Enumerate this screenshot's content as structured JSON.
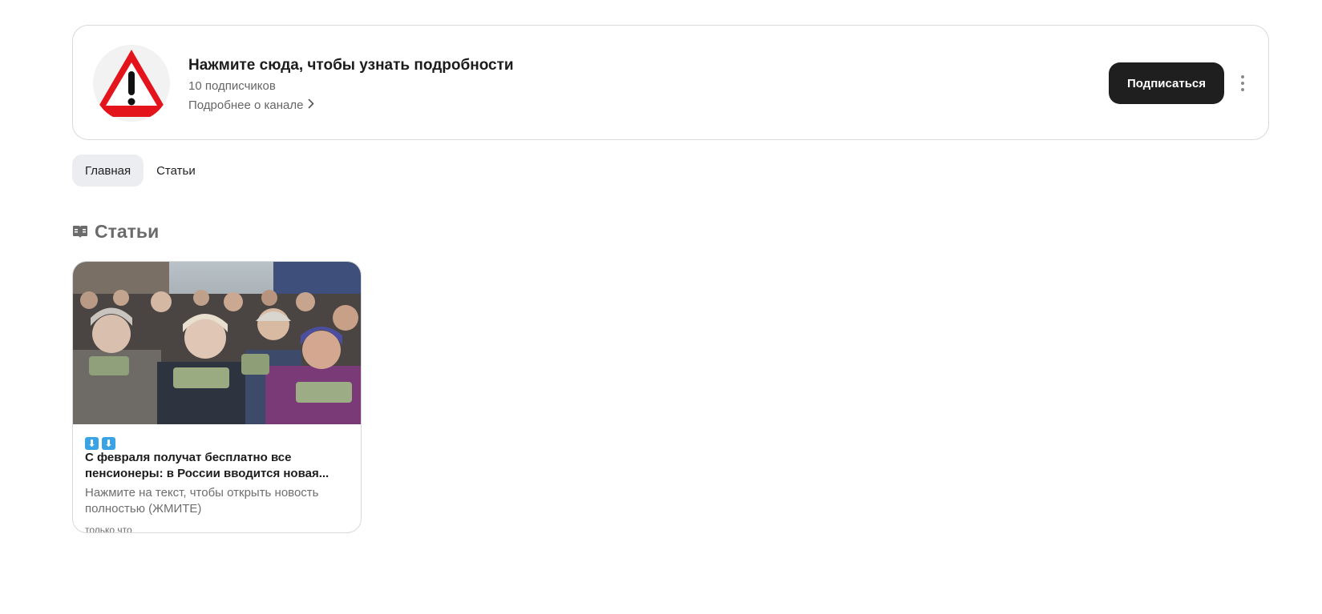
{
  "channel": {
    "title": "Нажмите сюда, чтобы узнать подробности",
    "subscribers": "10 подписчиков",
    "about_link": "Подробнее о канале",
    "subscribe_label": "Подписаться",
    "avatar_icon": "warning-triangle-icon",
    "more_icon": "more-vertical-icon"
  },
  "tabs": [
    {
      "label": "Главная",
      "active": true
    },
    {
      "label": "Статьи",
      "active": false
    }
  ],
  "section": {
    "title": "Статьи",
    "icon": "book-icon"
  },
  "articles": [
    {
      "emoji": "⬇️⬇️",
      "title": "С февраля получат бесплатно все пенсионеры: в России вводится новая...",
      "description": "Нажмите на текст, чтобы открыть новость полностью (ЖМИТЕ)",
      "time": "только что"
    }
  ],
  "colors": {
    "button_bg": "#1f1f1f",
    "active_tab_bg": "#ebedf0",
    "warning_red": "#e3141b"
  }
}
